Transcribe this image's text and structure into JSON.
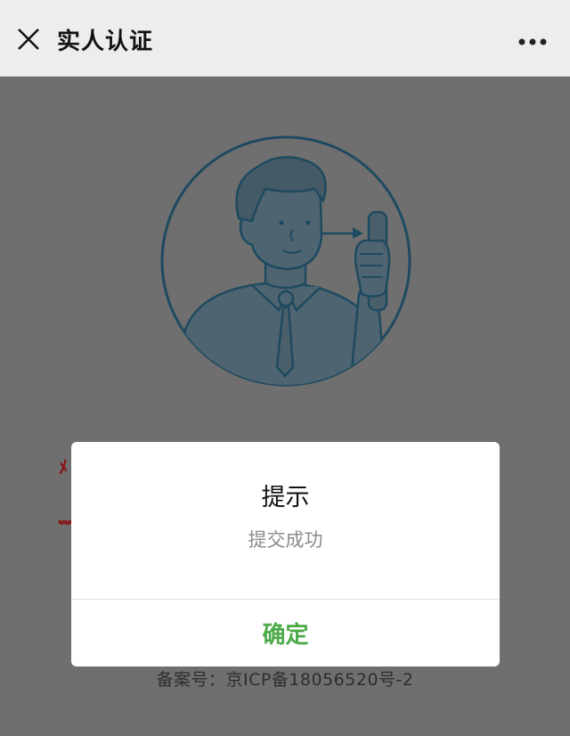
{
  "header": {
    "title": "实人认证",
    "close_icon": "close-icon",
    "more_icon": "more-icon"
  },
  "background": {
    "red_text_1": "ﾒ",
    "red_text_2": "﹌",
    "footer_text": "备案号：京ICP备18056520号-2"
  },
  "dialog": {
    "title": "提示",
    "message": "提交成功",
    "confirm_label": "确定",
    "confirm_color": "#4caa48"
  }
}
